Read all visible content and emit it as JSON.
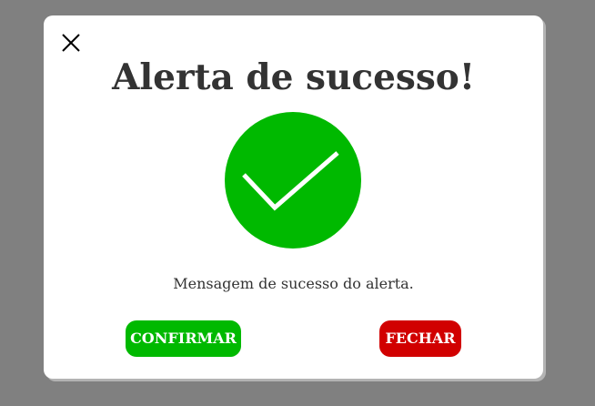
{
  "modal": {
    "title": "Alerta de sucesso!",
    "message": "Mensagem de sucesso do alerta.",
    "close_icon": "close-icon",
    "status_icon": "check-icon",
    "buttons": {
      "confirm_label": "CONFIRMAR",
      "close_label": "FECHAR"
    }
  },
  "colors": {
    "backdrop": "#808080",
    "modal_background": "#ffffff",
    "success": "#00b900",
    "danger": "#d10000",
    "text": "#333333"
  }
}
